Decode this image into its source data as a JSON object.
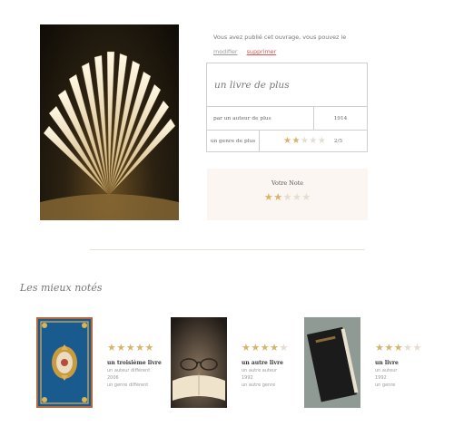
{
  "notice": {
    "text": "Vous avez publié cet ouvrage, vous pouvez le",
    "edit_label": "modifier",
    "delete_label": "supprimer"
  },
  "book": {
    "title": "un livre de plus",
    "author": "par un auteur de plus",
    "year": "1914",
    "genre": "un genre de plus",
    "rating": 2,
    "rating_text": "2/5"
  },
  "vote": {
    "label": "Votre Note",
    "value": 2
  },
  "top_rated": {
    "heading": "Les mieux notés",
    "books": [
      {
        "title": "un troisième livre",
        "author": "un auteur différent",
        "year": "2006",
        "genre": "un genre différent",
        "rating": 5
      },
      {
        "title": "un autre livre",
        "author": "un autre auteur",
        "year": "1992",
        "genre": "un autre genre",
        "rating": 4
      },
      {
        "title": "un livre",
        "author": "un auteur",
        "year": "1992",
        "genre": "un genre",
        "rating": 3
      }
    ]
  },
  "colors": {
    "star_on": "#d6b46c",
    "star_off": "#e4ddd0",
    "delete_link": "#d9534f",
    "vote_bg": "#fbf6f1"
  }
}
